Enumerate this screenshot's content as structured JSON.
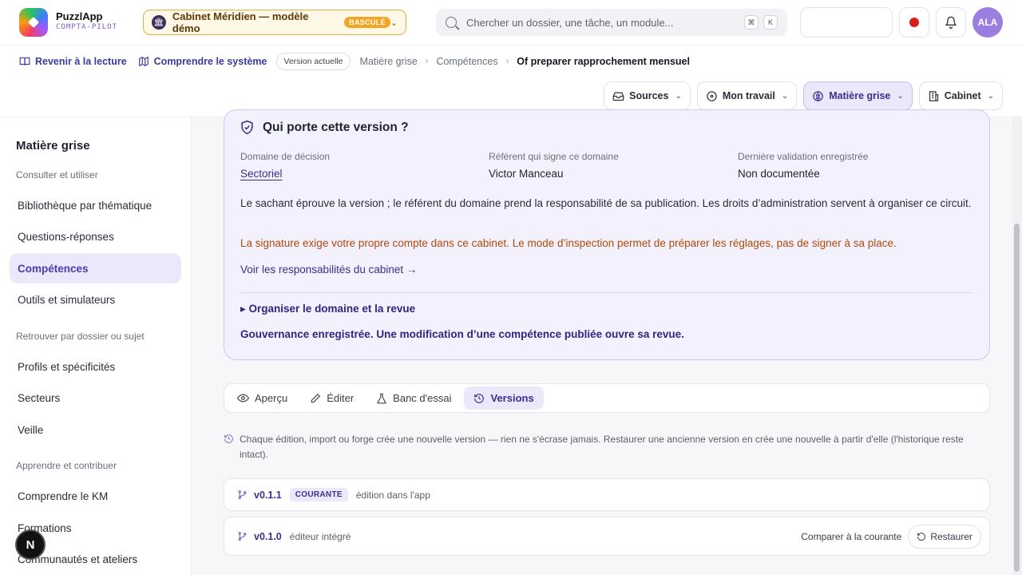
{
  "header": {
    "brand_name": "PuzzlApp",
    "brand_sub": "COMPTA-PILOT",
    "cabinet_label": "Cabinet Méridien — modèle démo",
    "cabinet_badge": "BASCULÉ",
    "search_placeholder": "Chercher un dossier, une tâche, un module...",
    "kbd_mod": "⌘",
    "kbd_key": "K",
    "avatar_initials": "ALA",
    "record_color": "#d91c1c"
  },
  "breadcrumb": {
    "back_label": "Revenir à la lecture",
    "understand_label": "Comprendre le système",
    "version_chip": "Version actuelle",
    "path": [
      "Matière grise",
      "Compétences"
    ],
    "current": "Of preparer rapprochement mensuel"
  },
  "nav_buttons": [
    {
      "label": "Sources",
      "icon": "inbox-icon"
    },
    {
      "label": "Mon travail",
      "icon": "target-icon"
    },
    {
      "label": "Matière grise",
      "icon": "brain-icon",
      "active": true
    },
    {
      "label": "Cabinet",
      "icon": "building-icon"
    }
  ],
  "sidebar": {
    "title": "Matière grise",
    "sections": [
      {
        "label": "Consulter et utiliser",
        "items": [
          "Bibliothèque par thématique",
          "Questions-réponses",
          "Compétences",
          "Outils et simulateurs"
        ]
      },
      {
        "label": "Retrouver par dossier ou sujet",
        "items": [
          "Profils et spécificités",
          "Secteurs",
          "Veille"
        ]
      },
      {
        "label": "Apprendre et contribuer",
        "items": [
          "Comprendre le KM",
          "Formations",
          "Communautés et ateliers"
        ]
      }
    ],
    "active_item": "Compétences",
    "n_badge": "N"
  },
  "governance": {
    "title": "Qui porte cette version ?",
    "domain_label": "Domaine de décision",
    "domain_value": "Sectoriel",
    "referent_label": "Référent qui signe ce domaine",
    "referent_value": "Victor Manceau",
    "validation_label": "Dernière validation enregistrée",
    "validation_value": "Non documentée",
    "paragraph": "Le sachant éprouve la version ; le référent du domaine prend la responsabilité de sa publication. Les droits d’administration servent à organiser ce circuit.",
    "warning": "La signature exige votre propre compte dans ce cabinet. Le mode d’inspection permet de préparer les réglages, pas de signer à sa place.",
    "link": "Voir les responsabilités du cabinet →",
    "details": "▸ Organiser le domaine et la revue",
    "note": "Gouvernance enregistrée. Une modification d’une compétence publiée ouvre sa revue.",
    "warn_color": "#b04a06"
  },
  "tabs": [
    {
      "label": "Aperçu",
      "icon": "eye-icon"
    },
    {
      "label": "Éditer",
      "icon": "pencil-icon"
    },
    {
      "label": "Banc d'essai",
      "icon": "flask-icon"
    },
    {
      "label": "Versions",
      "icon": "history-icon",
      "active": true
    }
  ],
  "versions": {
    "info": "Chaque édition, import ou forge crée une nouvelle version — rien ne s'écrase jamais. Restaurer une ancienne version en crée une nouvelle à partir d'elle (l'historique reste intact).",
    "rows": [
      {
        "number": "v0.1.1",
        "badge": "COURANTE",
        "desc": "édition dans l'app"
      },
      {
        "number": "v0.1.0",
        "desc": "éditeur intégré",
        "compare": "Comparer à la courante",
        "restore": "Restaurer"
      }
    ]
  }
}
